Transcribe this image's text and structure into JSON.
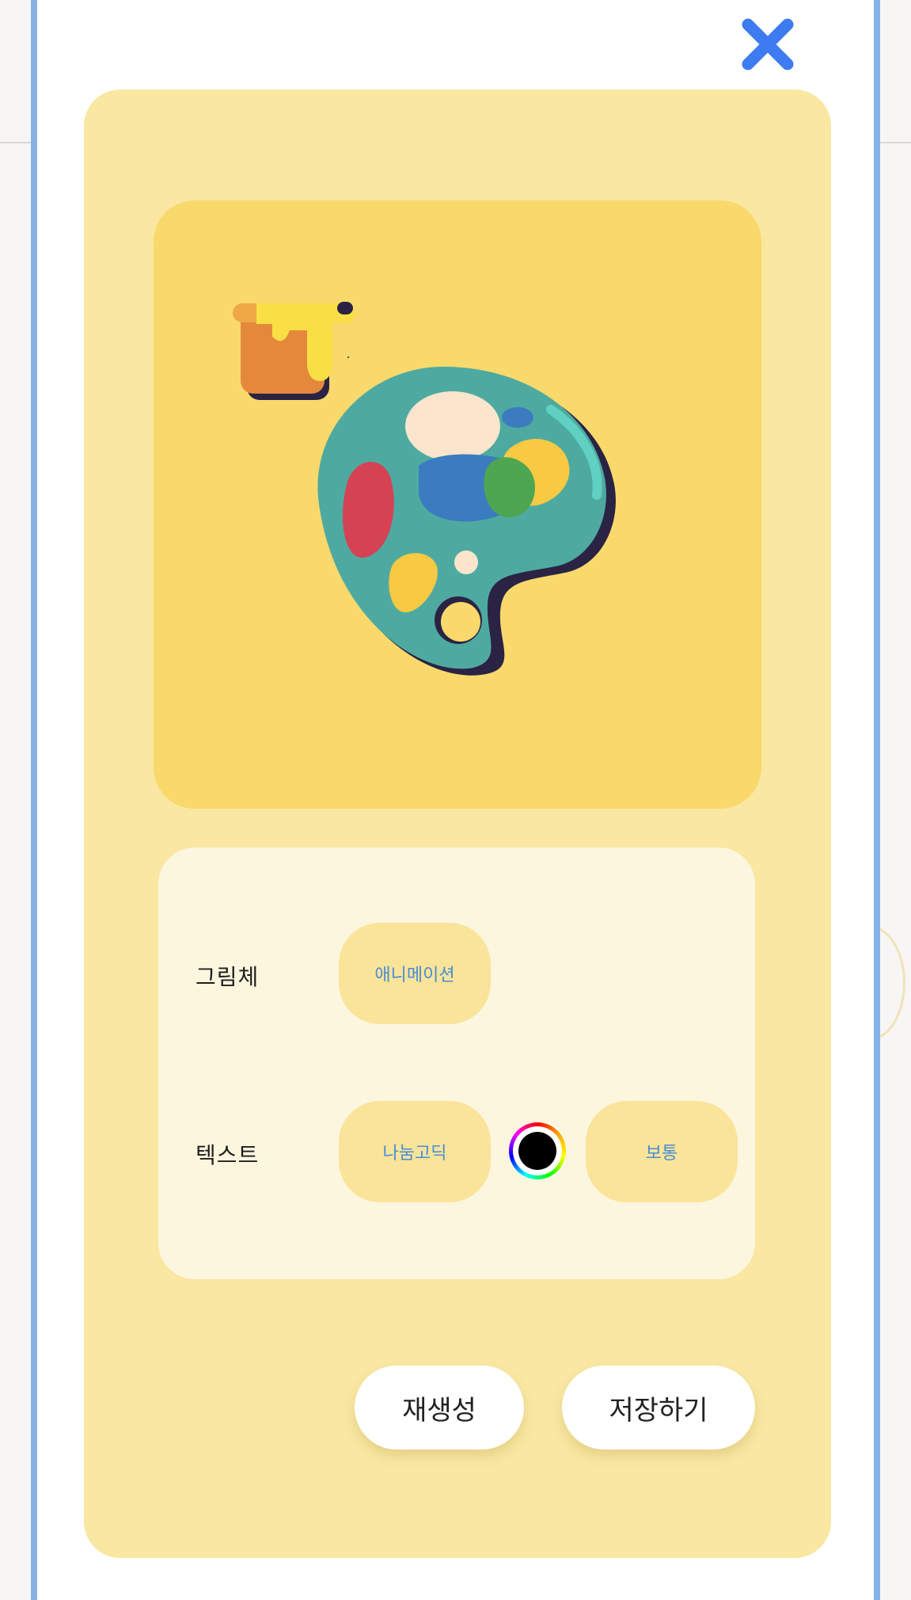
{
  "close": {
    "icon": "close-icon",
    "color": "#3d7bf0"
  },
  "preview": {
    "image": "paint-palette-with-paint-bucket-illustration",
    "background": "#f9d96c"
  },
  "options": {
    "style_row": {
      "label": "그림체",
      "value": "애니메이션"
    },
    "text_row": {
      "label": "텍스트",
      "font": "나눔고딕",
      "color_picker": {
        "icon": "color-wheel-icon",
        "selected_color": "#000000"
      },
      "weight": "보통"
    }
  },
  "actions": {
    "regenerate": "재생성",
    "save": "저장하기"
  },
  "colors": {
    "frame_border": "#86b2e8",
    "panel": "#f9e7a2",
    "options_card": "#fdf6df",
    "chip": "#f9e49a",
    "chip_text": "#4a8bd4"
  }
}
